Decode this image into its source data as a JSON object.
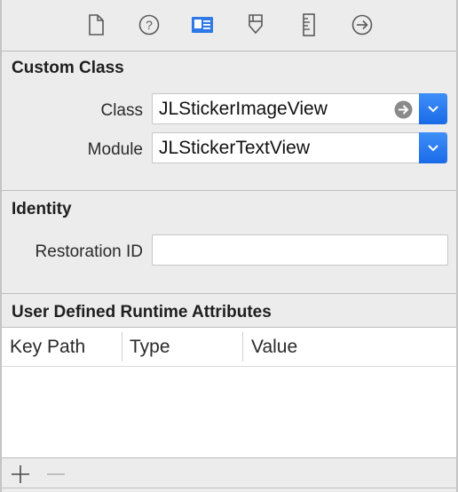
{
  "toolbar": {
    "icons": [
      "file-inspector-icon",
      "quick-help-icon",
      "identity-inspector-icon",
      "attributes-inspector-icon",
      "size-inspector-icon",
      "connections-inspector-icon"
    ],
    "selected": "identity-inspector-icon",
    "accent": "#2f78e8"
  },
  "custom_class": {
    "title": "Custom Class",
    "class_label": "Class",
    "class_value": "JLStickerImageView",
    "module_label": "Module",
    "module_value": "JLStickerTextView"
  },
  "identity": {
    "title": "Identity",
    "restoration_label": "Restoration ID",
    "restoration_value": ""
  },
  "runtime_attributes": {
    "title": "User Defined Runtime Attributes",
    "columns": [
      "Key Path",
      "Type",
      "Value"
    ],
    "rows": []
  },
  "bottom_bar": {
    "add_icon": "plus-icon",
    "remove_icon": "minus-icon"
  }
}
